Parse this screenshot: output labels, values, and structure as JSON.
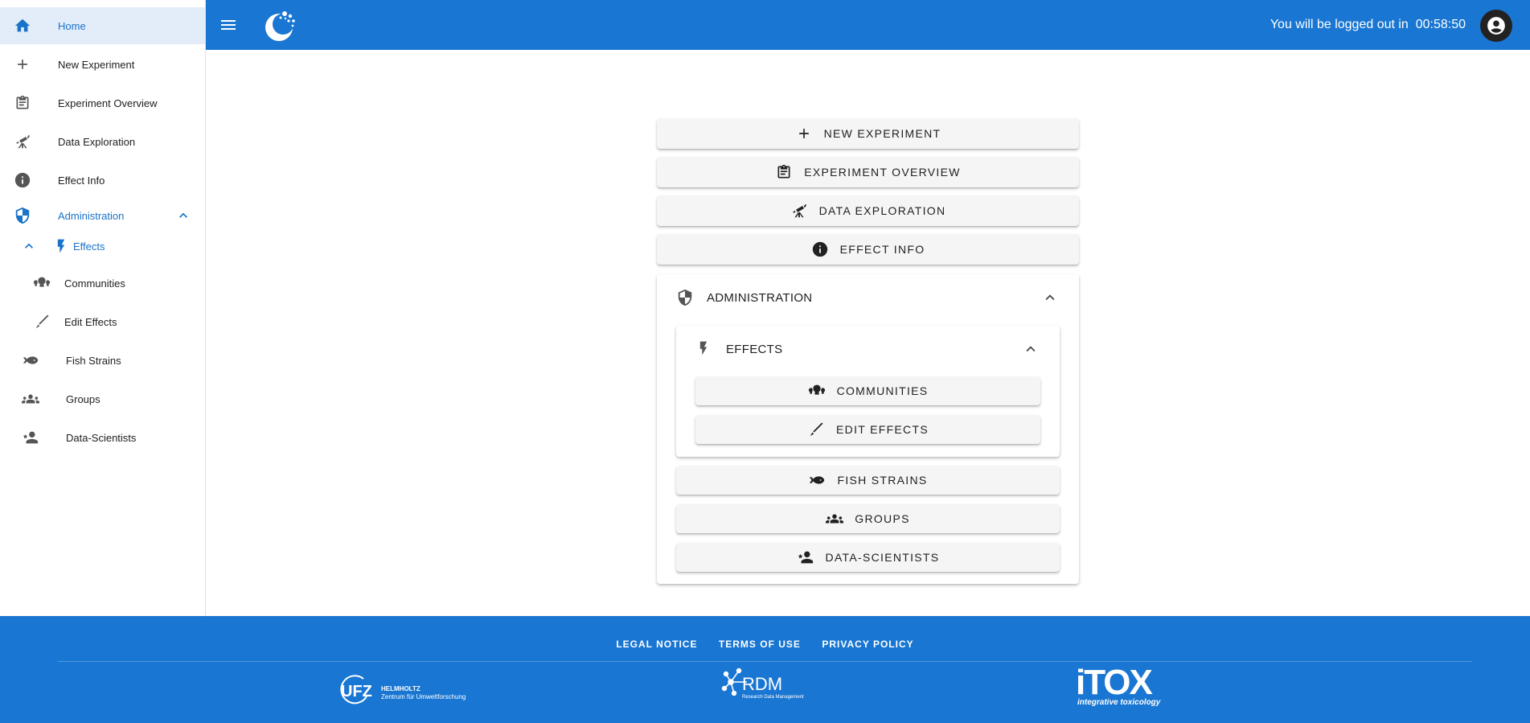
{
  "sidebar": {
    "items": [
      {
        "label": "Home",
        "icon": "home-icon"
      },
      {
        "label": "New Experiment",
        "icon": "plus-icon"
      },
      {
        "label": "Experiment Overview",
        "icon": "clipboard-icon"
      },
      {
        "label": "Data Exploration",
        "icon": "telescope-icon"
      },
      {
        "label": "Effect Info",
        "icon": "info-icon"
      },
      {
        "label": "Administration",
        "icon": "shield-icon"
      },
      {
        "label": "Effects",
        "icon": "lightning-icon"
      },
      {
        "label": "Communities",
        "icon": "communities-icon"
      },
      {
        "label": "Edit Effects",
        "icon": "pencil-icon"
      },
      {
        "label": "Fish Strains",
        "icon": "fish-icon"
      },
      {
        "label": "Groups",
        "icon": "groups-icon"
      },
      {
        "label": "Data-Scientists",
        "icon": "person-star-icon"
      }
    ]
  },
  "topbar": {
    "logout_text": "You will be logged out in  00:58:50"
  },
  "main": {
    "new_experiment": "NEW EXPERIMENT",
    "experiment_overview": "EXPERIMENT OVERVIEW",
    "data_exploration": "DATA EXPLORATION",
    "effect_info": "EFFECT INFO",
    "administration": "ADMINISTRATION",
    "effects": "EFFECTS",
    "communities": "COMMUNITIES",
    "edit_effects": "EDIT EFFECTS",
    "fish_strains": "FISH STRAINS",
    "groups": "GROUPS",
    "data_scientists": "DATA-SCIENTISTS"
  },
  "footer": {
    "links": [
      "LEGAL NOTICE",
      "TERMS OF USE",
      "PRIVACY POLICY"
    ],
    "logos": {
      "ufz": "UFZ",
      "ufz_sub1": "HELMHOLTZ",
      "ufz_sub2": "Zentrum für Umweltforschung",
      "rdm": "RDM",
      "rdm_sub": "Research Data Management",
      "itox": "iTOX",
      "itox_sub": "integrative toxicology"
    }
  },
  "colors": {
    "primary": "#1976d2",
    "active_bg": "#e3edf9",
    "active_text": "#1a73c8"
  }
}
